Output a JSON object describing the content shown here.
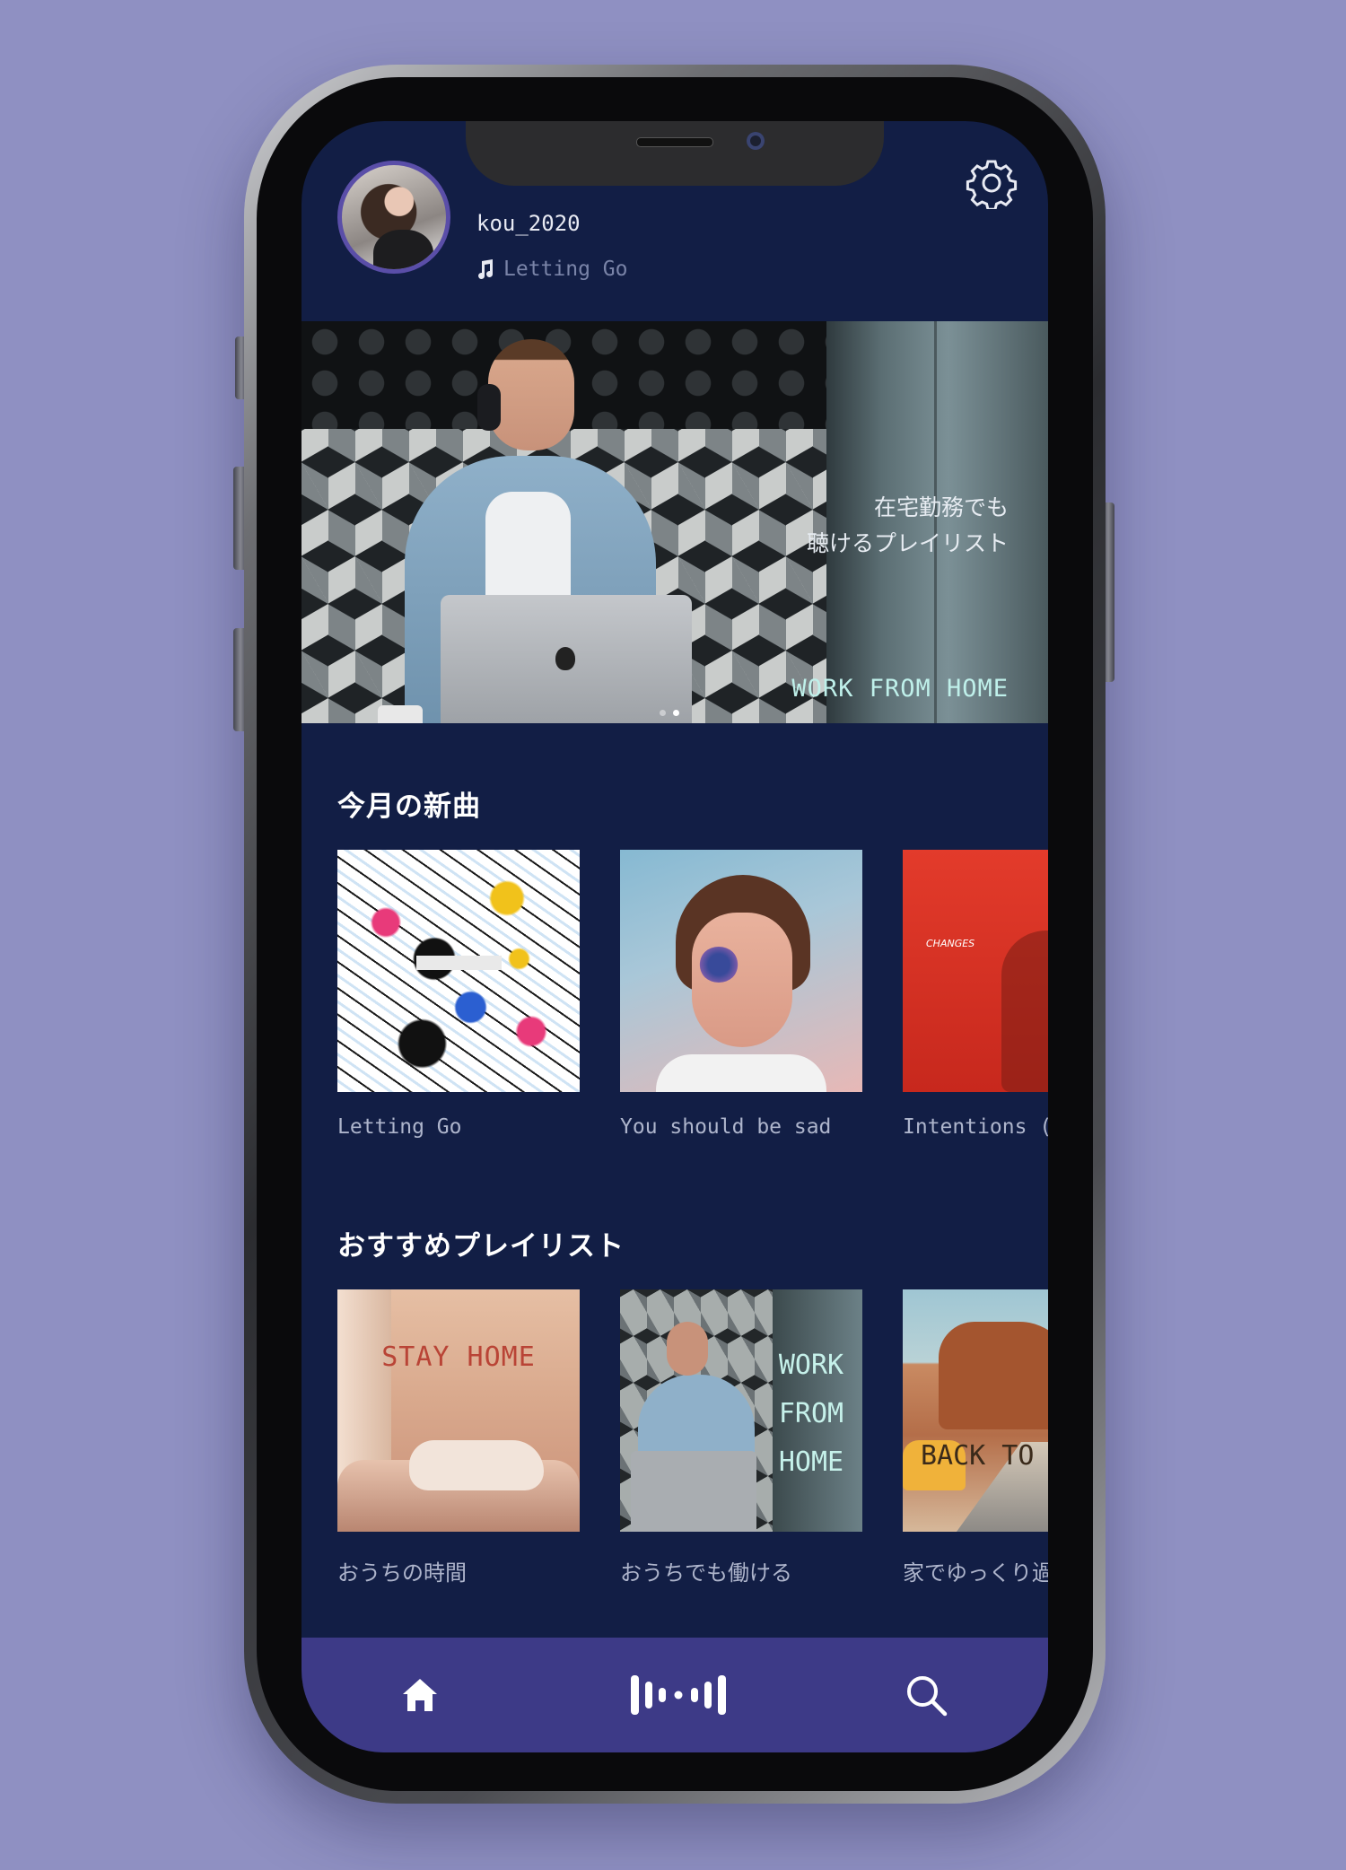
{
  "profile": {
    "username": "kou_2020",
    "now_playing": "Letting Go"
  },
  "banner": {
    "subtitle": "在宅勤務でも\n聴けるプレイリスト",
    "title": "WORK FROM HOME",
    "page_count": 2,
    "active_page": 2
  },
  "sections": {
    "new_songs": {
      "title": "今月の新曲",
      "items": [
        {
          "label": "Letting Go"
        },
        {
          "label": "You should be sad"
        },
        {
          "label": "Intentions (f"
        }
      ]
    },
    "playlists": {
      "title": "おすすめプレイリスト",
      "items": [
        {
          "label": "おうちの時間",
          "art_text": "STAY HOME"
        },
        {
          "label": "おうちでも働ける",
          "art_text": "WORK\nFROM\nHOME"
        },
        {
          "label": "家でゆっくり過",
          "art_text": "BACK TO"
        }
      ]
    }
  },
  "album_art_text": {
    "red_cover": "CHANGES"
  },
  "tabbar": {
    "items": [
      {
        "icon": "home-icon"
      },
      {
        "icon": "audio-wave-icon"
      },
      {
        "icon": "search-icon"
      }
    ]
  },
  "colors": {
    "background": "#8f90c2",
    "screen": "#121e45",
    "tabbar": "#3d3a87",
    "avatar_ring": "#5a4ea8",
    "banner_title": "#bff0ea"
  }
}
